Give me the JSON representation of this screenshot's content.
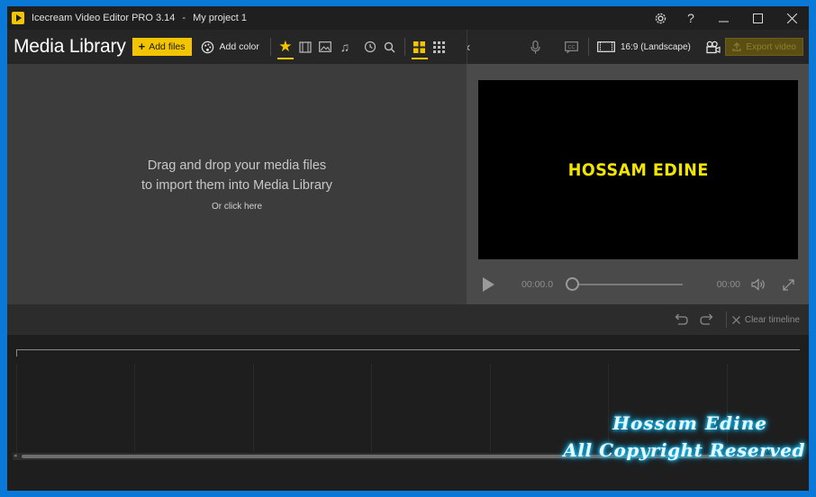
{
  "window": {
    "app_name": "Icecream Video Editor PRO 3.14",
    "separator": "-",
    "project_name": "My project 1"
  },
  "titlebar_controls": {
    "settings_icon": "gear-icon",
    "help_label": "?",
    "minimize_label": "—",
    "maximize_label": "☐",
    "close_label": "✕"
  },
  "media_library": {
    "title": "Media Library",
    "add_files_label": "Add files",
    "add_color_label": "Add color",
    "filters": [
      "favorites-star-icon",
      "video-icon",
      "image-icon",
      "music-icon",
      "recent-icon",
      "search-icon"
    ],
    "views": [
      "grid-large-icon",
      "grid-small-icon"
    ],
    "drop_line1": "Drag and drop your media files",
    "drop_line2": "to import them into Media Library",
    "click_here": "Or click here"
  },
  "preview": {
    "aspect_label": "16:9 (Landscape)",
    "export_label": "Export video",
    "video_text": "HOSSAM EDINE",
    "current_time": "00:00.0",
    "total_time": "00:00",
    "progress": 0
  },
  "timeline": {
    "clear_label": "Clear timeline"
  },
  "watermark": {
    "line1": "Hossam Edine",
    "line2": "All Copyright Reserved"
  },
  "colors": {
    "accent": "#f2c500",
    "window_border": "#0a78d7",
    "video_text": "#f2e600",
    "watermark_glow": "#19c6ff"
  }
}
